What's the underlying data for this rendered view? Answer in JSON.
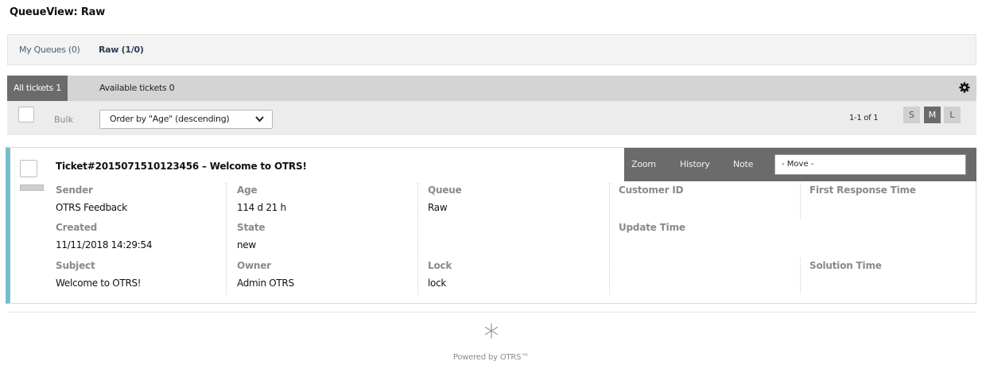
{
  "page": {
    "title": "QueueView: Raw"
  },
  "queues": [
    {
      "label": "My Queues (0)",
      "active": false
    },
    {
      "label": "Raw (1/0)",
      "active": true
    }
  ],
  "tabs": {
    "all": "All tickets 1",
    "available": "Available tickets 0"
  },
  "toolbar": {
    "bulk": "Bulk",
    "order_by": "Order by \"Age\" (descending)",
    "pagination": "1-1 of 1",
    "sizes": [
      "S",
      "M",
      "L"
    ],
    "active_size": "M"
  },
  "ticket": {
    "title": "Ticket#2015071510123456 – Welcome to OTRS!",
    "actions": {
      "zoom": "Zoom",
      "history": "History",
      "note": "Note",
      "move": "- Move -"
    },
    "fields": {
      "sender_label": "Sender",
      "sender": "OTRS Feedback",
      "created_label": "Created",
      "created": "11/11/2018 14:29:54",
      "subject_label": "Subject",
      "subject": "Welcome to OTRS!",
      "age_label": "Age",
      "age": "114 d 21 h",
      "state_label": "State",
      "state": "new",
      "owner_label": "Owner",
      "owner": "Admin OTRS",
      "queue_label": "Queue",
      "queue": "Raw",
      "lock_label": "Lock",
      "lock": "lock",
      "customer_id_label": "Customer ID",
      "update_time_label": "Update Time",
      "first_response_label": "First Response Time",
      "solution_time_label": "Solution Time"
    },
    "stripe_color": "#78bccb"
  },
  "footer": {
    "powered_by": "Powered by OTRS™"
  },
  "icons": {
    "settings": "gear-icon",
    "order_dropdown": "chevron-down-icon",
    "logo": "otrs-asterisk-logo"
  }
}
